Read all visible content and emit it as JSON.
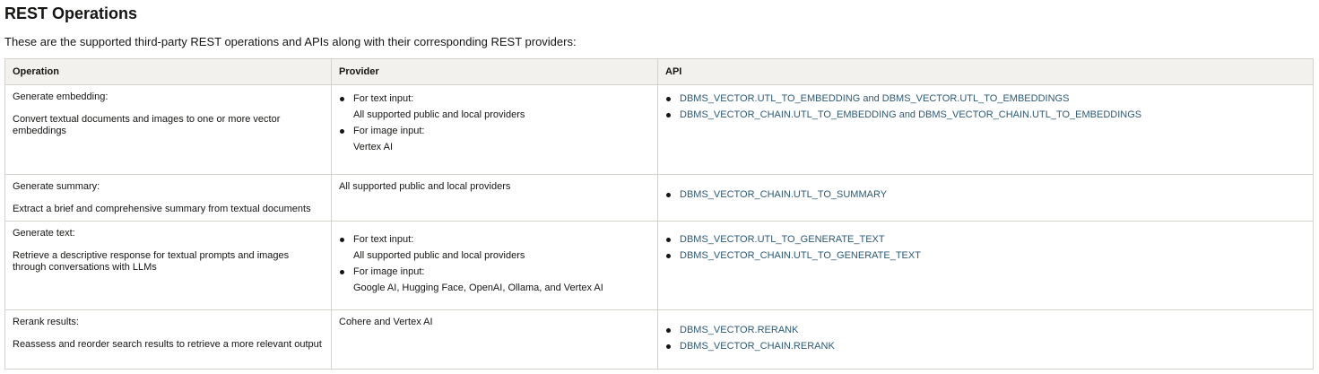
{
  "page": {
    "title": "REST Operations",
    "intro": "These are the supported third-party REST operations and APIs along with their corresponding REST providers:"
  },
  "table": {
    "headers": [
      "Operation",
      "Provider",
      "API"
    ],
    "rows": [
      {
        "operation": "Generate embedding:",
        "description": "Convert textual documents and images to one or more vector embeddings",
        "providers": [
          {
            "label": "For text input:",
            "value": "All supported public and local providers"
          },
          {
            "label": "For image input:",
            "value": "Vertex AI"
          }
        ],
        "apis": [
          "DBMS_VECTOR.UTL_TO_EMBEDDING and DBMS_VECTOR.UTL_TO_EMBEDDINGS",
          "DBMS_VECTOR_CHAIN.UTL_TO_EMBEDDING and DBMS_VECTOR_CHAIN.UTL_TO_EMBEDDINGS"
        ]
      },
      {
        "operation": "Generate summary:",
        "description": "Extract a brief and comprehensive summary from textual documents",
        "provider_text": "All supported public and local providers",
        "apis": [
          "DBMS_VECTOR_CHAIN.UTL_TO_SUMMARY"
        ]
      },
      {
        "operation": "Generate text:",
        "description": "Retrieve a descriptive response for textual prompts and images through conversations with LLMs",
        "providers": [
          {
            "label": "For text input:",
            "value": "All supported public and local providers"
          },
          {
            "label": "For image input:",
            "value": "Google AI, Hugging Face, OpenAI, Ollama, and Vertex AI"
          }
        ],
        "apis": [
          "DBMS_VECTOR.UTL_TO_GENERATE_TEXT",
          "DBMS_VECTOR_CHAIN.UTL_TO_GENERATE_TEXT"
        ]
      },
      {
        "operation": "Rerank results:",
        "description": "Reassess and reorder search results to retrieve a more relevant output",
        "provider_text": "Cohere and Vertex AI",
        "apis": [
          "DBMS_VECTOR.RERANK",
          "DBMS_VECTOR_CHAIN.RERANK"
        ]
      }
    ]
  },
  "colors": {
    "link": "#2d5a77",
    "header_bg": "#f2f1ee",
    "border": "#d7d3cc",
    "text": "#161513"
  }
}
